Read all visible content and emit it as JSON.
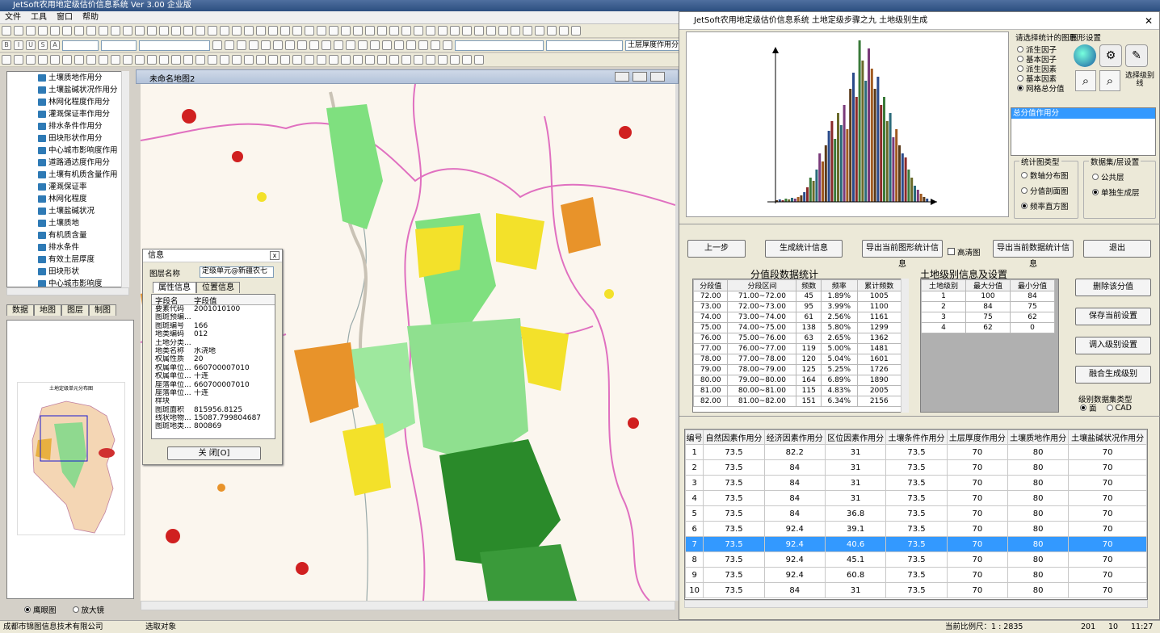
{
  "app": {
    "title": "JetSoft农用地定级估价信息系统 Ver 3.00 企业版"
  },
  "menu": [
    "文件",
    "工具",
    "窗口",
    "帮助"
  ],
  "toolbar": {
    "layer_dropdown": "土层厚度作用分统计图"
  },
  "tree": {
    "items": [
      "土壤质地作用分",
      "土壤盐碱状况作用分",
      "林网化程度作用分",
      "灌溉保证率作用分",
      "排水条件作用分",
      "田块形状作用分",
      "中心城市影响度作用",
      "道路通达度作用分",
      "土壤有机质含量作用",
      "灌溉保证率",
      "林网化程度",
      "土壤盐碱状况",
      "土壤质地",
      "有机质含量",
      "排水条件",
      "有效土层厚度",
      "田块形状",
      "中心城市影响度"
    ]
  },
  "left_tabs": [
    "数据",
    "地图",
    "图层",
    "制图"
  ],
  "overview": {
    "title": "土地定级单元分布图",
    "radio_eagle": "鹰眼图",
    "radio_zoom": "放大镜"
  },
  "map_window": {
    "title": "未命名地图2"
  },
  "info_dialog": {
    "title": "信息",
    "layer_label": "图层名称",
    "layer_value": "定级单元@新疆农七",
    "tabs": [
      "属性信息",
      "位置信息"
    ],
    "col_name": "字段名",
    "col_value": "字段值",
    "fields": [
      [
        "要素代码",
        "2001010100"
      ],
      [
        "图斑预编...",
        ""
      ],
      [
        "图斑编号",
        "166"
      ],
      [
        "地类编码",
        "012"
      ],
      [
        "土地分类...",
        ""
      ],
      [
        "地类名称",
        "水浇地"
      ],
      [
        "权属性质",
        "20"
      ],
      [
        "权属单位...",
        "660700007010"
      ],
      [
        "权属单位...",
        "十连"
      ],
      [
        "座落单位...",
        "660700007010"
      ],
      [
        "座落单位...",
        "十连"
      ],
      [
        "样块",
        ""
      ],
      [
        "图斑面积",
        "815956.8125"
      ],
      [
        "线状地物...",
        "15087.799804687"
      ],
      [
        "图斑地类...",
        "800869"
      ]
    ],
    "close": "关 闭[O]"
  },
  "right": {
    "title": "JetSoft农用地定级估价信息系统  土地定级步骤之九  土地级别生成",
    "select_label": "请选择统计的图形",
    "graph_setting": "图形设置",
    "options": [
      "派生因子",
      "基本因子",
      "派生因素",
      "基本因素",
      "网格总分值"
    ],
    "selected_option": 4,
    "select_level_line": "选择级别线",
    "listbox_item": "总分值作用分",
    "chart_type_label": "统计图类型",
    "chart_types": [
      "数轴分布图",
      "分值剖面图",
      "频率直方图"
    ],
    "chart_type_selected": 2,
    "dataset_label": "数据集/层设置",
    "datasets": [
      "公共层",
      "单独生成层"
    ],
    "dataset_selected": 1,
    "buttons": {
      "prev": "上一步",
      "gen_stat": "生成统计信息",
      "export_chart": "导出当前图形统计信息",
      "hd": "高清图",
      "export_data": "导出当前数据统计信息",
      "exit": "退出",
      "delete_score": "删除该分值",
      "save": "保存当前设置",
      "load": "调入级别设置",
      "merge": "融合生成级别"
    },
    "seg_title": "分值段数据统计",
    "seg_headers": [
      "分段值",
      "分段区间",
      "频数",
      "频率",
      "累计频数"
    ],
    "seg_rows": [
      [
        "72.00",
        "71.00~72.00",
        "45",
        "1.89%",
        "1005"
      ],
      [
        "73.00",
        "72.00~73.00",
        "95",
        "3.99%",
        "1100"
      ],
      [
        "74.00",
        "73.00~74.00",
        "61",
        "2.56%",
        "1161"
      ],
      [
        "75.00",
        "74.00~75.00",
        "138",
        "5.80%",
        "1299"
      ],
      [
        "76.00",
        "75.00~76.00",
        "63",
        "2.65%",
        "1362"
      ],
      [
        "77.00",
        "76.00~77.00",
        "119",
        "5.00%",
        "1481"
      ],
      [
        "78.00",
        "77.00~78.00",
        "120",
        "5.04%",
        "1601"
      ],
      [
        "79.00",
        "78.00~79.00",
        "125",
        "5.25%",
        "1726"
      ],
      [
        "80.00",
        "79.00~80.00",
        "164",
        "6.89%",
        "1890"
      ],
      [
        "81.00",
        "80.00~81.00",
        "115",
        "4.83%",
        "2005"
      ],
      [
        "82.00",
        "81.00~82.00",
        "151",
        "6.34%",
        "2156"
      ]
    ],
    "level_title": "土地级别信息及设置",
    "level_headers": [
      "土地级别",
      "最大分值",
      "最小分值"
    ],
    "level_rows": [
      [
        "1",
        "100",
        "84"
      ],
      [
        "2",
        "84",
        "75"
      ],
      [
        "3",
        "75",
        "62"
      ],
      [
        "4",
        "62",
        "0"
      ]
    ],
    "level_dataset_label": "级别数据集类型",
    "level_dataset_opts": [
      "面",
      "CAD"
    ],
    "level_dataset_selected": 0,
    "grid_headers": [
      "编号",
      "自然因素作用分",
      "经济因素作用分",
      "区位因素作用分",
      "土壤条件作用分",
      "土层厚度作用分",
      "土壤质地作用分",
      "土壤盐碱状况作用分"
    ],
    "grid_rows": [
      [
        "1",
        "73.5",
        "82.2",
        "31",
        "73.5",
        "70",
        "80",
        "70"
      ],
      [
        "2",
        "73.5",
        "84",
        "31",
        "73.5",
        "70",
        "80",
        "70"
      ],
      [
        "3",
        "73.5",
        "84",
        "31",
        "73.5",
        "70",
        "80",
        "70"
      ],
      [
        "4",
        "73.5",
        "84",
        "31",
        "73.5",
        "70",
        "80",
        "70"
      ],
      [
        "5",
        "73.5",
        "84",
        "36.8",
        "73.5",
        "70",
        "80",
        "70"
      ],
      [
        "6",
        "73.5",
        "92.4",
        "39.1",
        "73.5",
        "70",
        "80",
        "70"
      ],
      [
        "7",
        "73.5",
        "92.4",
        "40.6",
        "73.5",
        "70",
        "80",
        "70"
      ],
      [
        "8",
        "73.5",
        "92.4",
        "45.1",
        "73.5",
        "70",
        "80",
        "70"
      ],
      [
        "9",
        "73.5",
        "92.4",
        "60.8",
        "73.5",
        "70",
        "80",
        "70"
      ],
      [
        "10",
        "73.5",
        "84",
        "31",
        "73.5",
        "70",
        "80",
        "70"
      ]
    ],
    "grid_selected_index": 6
  },
  "status": {
    "company": "成都市锦图信息技术有限公司",
    "action": "选取对象",
    "scale": "当前比例尺：1 : 2835",
    "p1": "201",
    "p2": "10",
    "clock": "11:27"
  },
  "colors": {
    "accent": "#3399ff",
    "grass": "#7fe07f",
    "forest": "#2a8a2a",
    "yellow": "#f3e12a",
    "orange": "#e8932a",
    "boundary": "#e070c0"
  }
}
